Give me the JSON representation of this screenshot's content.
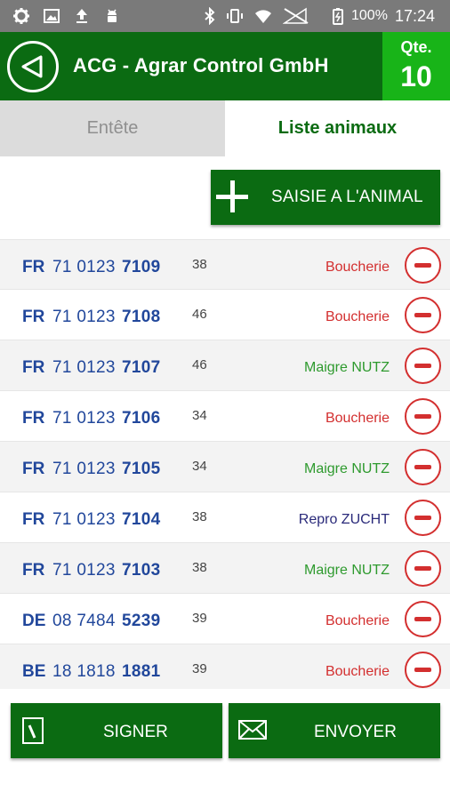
{
  "status_bar": {
    "battery_percent": "100%",
    "time": "17:24",
    "icons": [
      "settings-icon",
      "image-icon",
      "upload-icon",
      "android-icon",
      "bluetooth-icon",
      "vibrate-icon",
      "wifi-icon",
      "signal-icon",
      "battery-icon"
    ]
  },
  "header": {
    "title": "ACG - Agrar Control GmbH",
    "qty_label": "Qte.",
    "qty_value": "10"
  },
  "tabs": {
    "header_tab": "Entête",
    "animals_tab": "Liste animaux"
  },
  "add_button": {
    "label": "SAISIE A L'ANIMAL"
  },
  "animals": [
    {
      "country": "FR",
      "mid": "71 0123",
      "last": "7109",
      "age": "38",
      "category": "Boucherie",
      "category_color": "#d32f2f"
    },
    {
      "country": "FR",
      "mid": "71 0123",
      "last": "7108",
      "age": "46",
      "category": "Boucherie",
      "category_color": "#d32f2f"
    },
    {
      "country": "FR",
      "mid": "71 0123",
      "last": "7107",
      "age": "46",
      "category": "Maigre NUTZ",
      "category_color": "#2e9a2e"
    },
    {
      "country": "FR",
      "mid": "71 0123",
      "last": "7106",
      "age": "34",
      "category": "Boucherie",
      "category_color": "#d32f2f"
    },
    {
      "country": "FR",
      "mid": "71 0123",
      "last": "7105",
      "age": "34",
      "category": "Maigre NUTZ",
      "category_color": "#2e9a2e"
    },
    {
      "country": "FR",
      "mid": "71 0123",
      "last": "7104",
      "age": "38",
      "category": "Repro ZUCHT",
      "category_color": "#2a2a7a"
    },
    {
      "country": "FR",
      "mid": "71 0123",
      "last": "7103",
      "age": "38",
      "category": "Maigre NUTZ",
      "category_color": "#2e9a2e"
    },
    {
      "country": "DE",
      "mid": "08 7484",
      "last": "5239",
      "age": "39",
      "category": "Boucherie",
      "category_color": "#d32f2f"
    },
    {
      "country": "BE",
      "mid": "18 1818",
      "last": "1881",
      "age": "39",
      "category": "Boucherie",
      "category_color": "#d32f2f"
    }
  ],
  "footer": {
    "sign_label": "SIGNER",
    "send_label": "ENVOYER"
  },
  "colors": {
    "brand_green": "#0b6b12",
    "accent_green": "#18b418",
    "id_blue": "#21479b",
    "remove_red": "#d32f2f"
  }
}
